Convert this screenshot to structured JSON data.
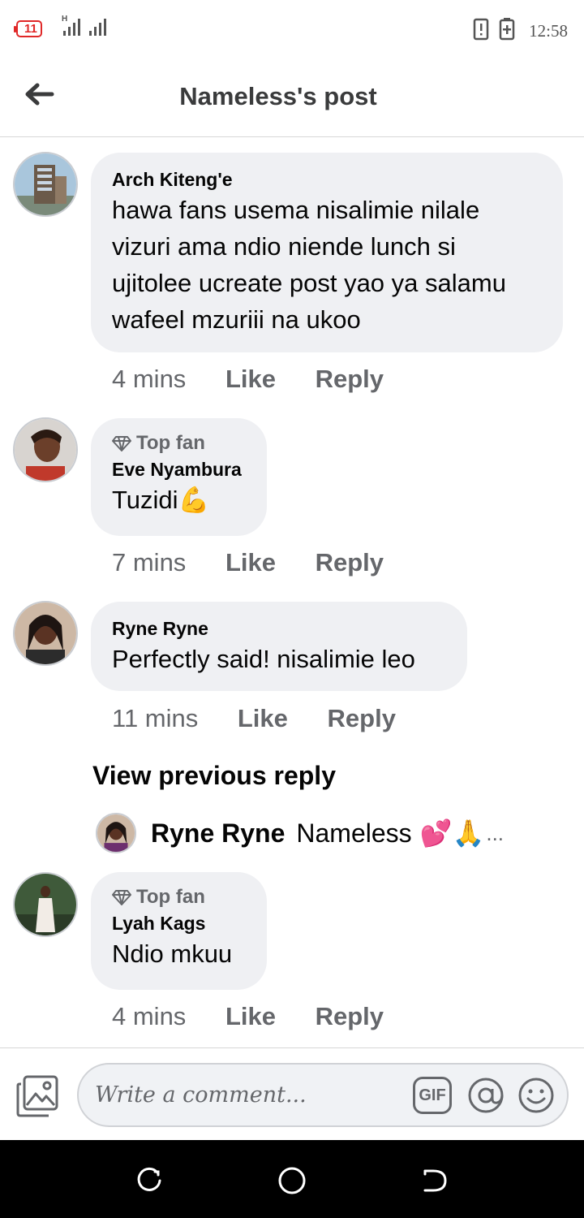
{
  "status_bar": {
    "battery_level": "11",
    "network_type": "H",
    "time": "12:58"
  },
  "header": {
    "title": "Nameless's post",
    "back_icon": "arrow-left-icon"
  },
  "comments": [
    {
      "author": "Arch Kiteng'e",
      "top_fan": false,
      "lines": [
        "hawa fans usema nisalimie nilale",
        "vizuri ama ndio niende lunch si",
        "ujitolee ucreate post yao ya salamu",
        "wafeel mzuriii na ukoo"
      ],
      "time": "4 mins",
      "like_label": "Like",
      "reply_label": "Reply"
    },
    {
      "author": "Eve Nyambura",
      "top_fan": true,
      "top_fan_label": "Top fan",
      "text": "Tuzidi",
      "emoji": "💪",
      "time": "7 mins",
      "like_label": "Like",
      "reply_label": "Reply"
    },
    {
      "author": "Ryne Ryne",
      "top_fan": false,
      "text": "Perfectly said! nisalimie leo",
      "time": "11 mins",
      "like_label": "Like",
      "reply_label": "Reply",
      "view_previous_label": "View previous reply",
      "reply_preview": {
        "author": "Ryne Ryne",
        "text": "Nameless",
        "emojis": "💕🙏",
        "ellipsis": "..."
      }
    },
    {
      "author": "Lyah Kags",
      "top_fan": true,
      "top_fan_label": "Top fan",
      "text": "Ndio mkuu",
      "time": "4 mins",
      "like_label": "Like",
      "reply_label": "Reply"
    }
  ],
  "composer": {
    "placeholder": "Write a comment...",
    "gif_label": "GIF",
    "icons": [
      "photo-icon",
      "gif-icon",
      "at-mention-icon",
      "smiley-icon"
    ]
  },
  "navbar": {
    "icons": [
      "recent-apps-icon",
      "home-icon",
      "back-icon"
    ]
  }
}
